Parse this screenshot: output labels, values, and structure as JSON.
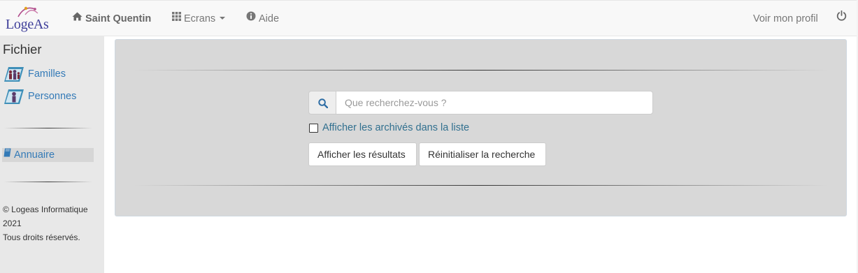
{
  "navbar": {
    "brand": "LogeAs",
    "home_label": "Saint Quentin",
    "screens_label": "Ecrans",
    "help_label": "Aide",
    "profile_label": "Voir mon profil"
  },
  "sidebar": {
    "heading": "Fichier",
    "items": [
      {
        "label": "Familles"
      },
      {
        "label": "Personnes"
      }
    ],
    "directory_label": "Annuaire",
    "footer": {
      "line1": "© Logeas Informatique",
      "line2": "2021",
      "line3": "Tous droits réservés."
    }
  },
  "search": {
    "placeholder": "Que recherchez-vous ?",
    "value": "",
    "archived_checkbox_label": "Afficher les archivés dans la liste",
    "archived_checked": false,
    "show_results_label": "Afficher les résultats",
    "reset_label": "Réinitialiser la recherche"
  },
  "icons": {
    "home": "home-icon",
    "screens": "grid-icon",
    "help": "info-icon",
    "power": "power-icon",
    "search": "search-icon",
    "families": "family-icon",
    "persons": "person-icon",
    "directory": "book-icon"
  },
  "colors": {
    "link": "#337ab7",
    "checkbox_label": "#31708f",
    "brand": "#3f3f9a",
    "panel_bg": "#d8d8d8",
    "sidebar_bg": "#e8e8e8"
  }
}
